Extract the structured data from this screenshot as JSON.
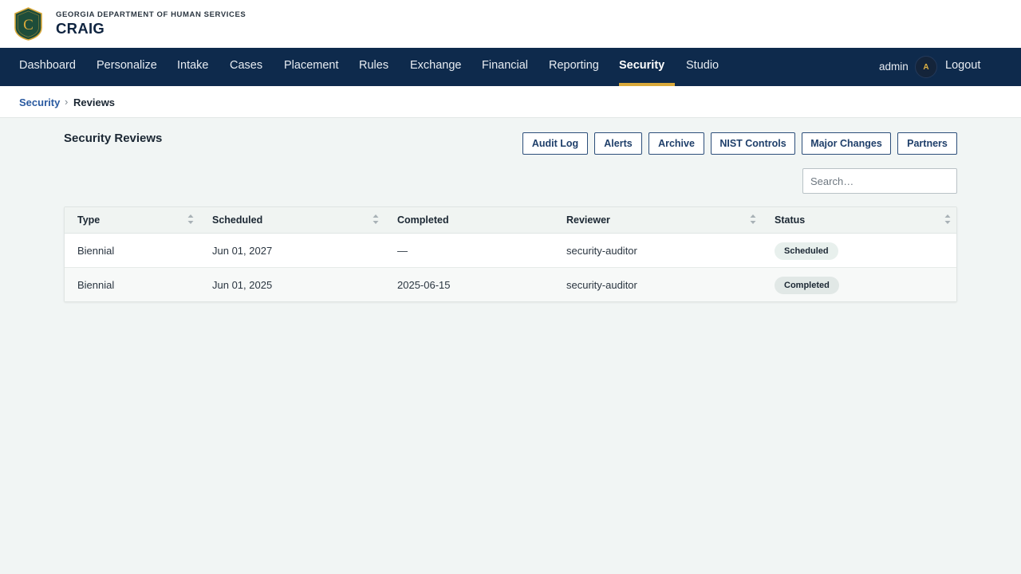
{
  "brand": {
    "org_name": "GEORGIA DEPARTMENT OF HUMAN SERVICES",
    "app_name": "CRAIG",
    "logo_letter": "C"
  },
  "nav": {
    "items": [
      {
        "label": "Dashboard"
      },
      {
        "label": "Personalize"
      },
      {
        "label": "Intake"
      },
      {
        "label": "Cases"
      },
      {
        "label": "Placement"
      },
      {
        "label": "Rules"
      },
      {
        "label": "Exchange"
      },
      {
        "label": "Financial"
      },
      {
        "label": "Reporting"
      },
      {
        "label": "Security",
        "active": true
      },
      {
        "label": "Studio"
      }
    ],
    "user": "admin",
    "avatar_initial": "A",
    "logout_label": "Logout"
  },
  "breadcrumb": {
    "parent": "Security",
    "separator": "›",
    "current": "Reviews"
  },
  "page": {
    "title": "Security Reviews"
  },
  "toolbar": {
    "buttons": [
      "Audit Log",
      "Alerts",
      "Archive",
      "NIST Controls",
      "Major Changes",
      "Partners"
    ]
  },
  "search": {
    "placeholder": "Search…",
    "value": ""
  },
  "table": {
    "columns": [
      "Type",
      "Scheduled",
      "Completed",
      "Reviewer",
      "Status"
    ],
    "rows": [
      {
        "type": "Biennial",
        "scheduled": "Jun 01, 2027",
        "completed": "—",
        "reviewer": "security-auditor",
        "status": "Scheduled"
      },
      {
        "type": "Biennial",
        "scheduled": "Jun 01, 2025",
        "completed": "2025-06-15",
        "reviewer": "security-auditor",
        "status": "Completed"
      }
    ]
  },
  "colors": {
    "nav_bg": "#0e2a4c",
    "nav_active_underline": "#d9a93a",
    "page_bg": "#f1f5f4",
    "link": "#2a5aa0",
    "logo_shield": "#1e4d3a",
    "logo_gold": "#d9a93a"
  },
  "icons": {
    "logo": "shield-emblem",
    "sort": "sort-arrows-icon"
  }
}
